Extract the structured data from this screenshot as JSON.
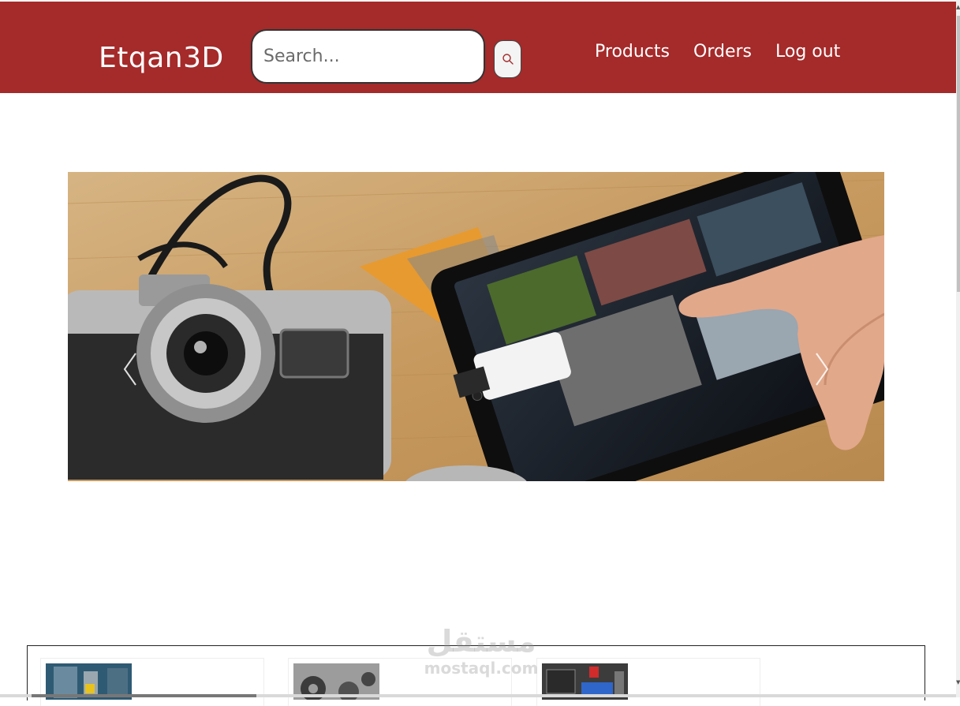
{
  "navbar": {
    "brand": "Etqan3D",
    "background_color": "#a52a2a",
    "search": {
      "placeholder": "Search...",
      "value": "",
      "button_icon": "search-icon"
    },
    "links": [
      {
        "label": "Products"
      },
      {
        "label": "Orders"
      },
      {
        "label": "Log out"
      }
    ]
  },
  "carousel": {
    "slide_description": "camera and tablet with card reader",
    "prev_icon": "chevron-left-icon",
    "next_icon": "chevron-right-icon"
  },
  "products": {
    "cards": [
      {
        "thumbnail": "3d-printer-machine"
      },
      {
        "thumbnail": "3d-printed-gears"
      },
      {
        "thumbnail": "3d-printer-setup"
      }
    ]
  },
  "watermark": {
    "arabic": "مستقل",
    "latin": "mostaql.com"
  }
}
